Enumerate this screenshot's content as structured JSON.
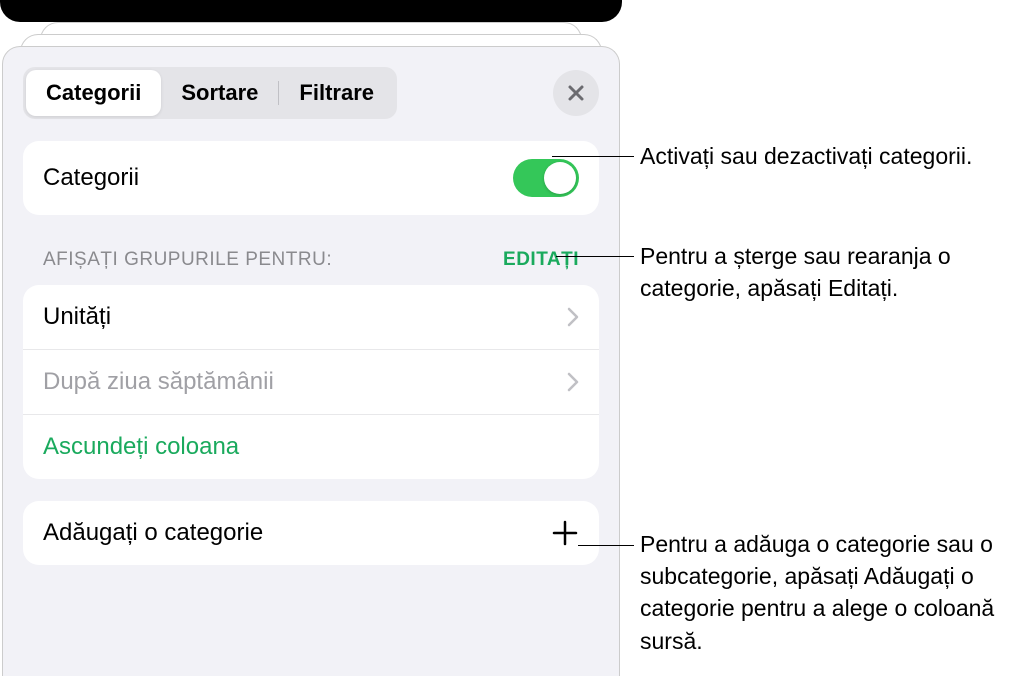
{
  "tabs": [
    "Categorii",
    "Sortare",
    "Filtrare"
  ],
  "activeTab": 0,
  "toggleRow": {
    "label": "Categorii",
    "enabled": true
  },
  "groupsSection": {
    "headerLabel": "AFIȘAȚI GRUPURILE PENTRU:",
    "editLabel": "EDITAȚI",
    "items": [
      {
        "label": "Unități"
      },
      {
        "label": "După ziua săptămânii"
      }
    ],
    "hideColumnLabel": "Ascundeți coloana"
  },
  "addCategory": {
    "label": "Adăugați o categorie"
  },
  "callouts": {
    "c1": "Activați sau dezactivați categorii.",
    "c2": "Pentru a șterge sau rearanja o categorie, apăsați Editați.",
    "c3": "Pentru a adăuga o categorie sau o subcategorie, apăsați Adăugați o categorie pentru a alege o coloană sursă."
  }
}
